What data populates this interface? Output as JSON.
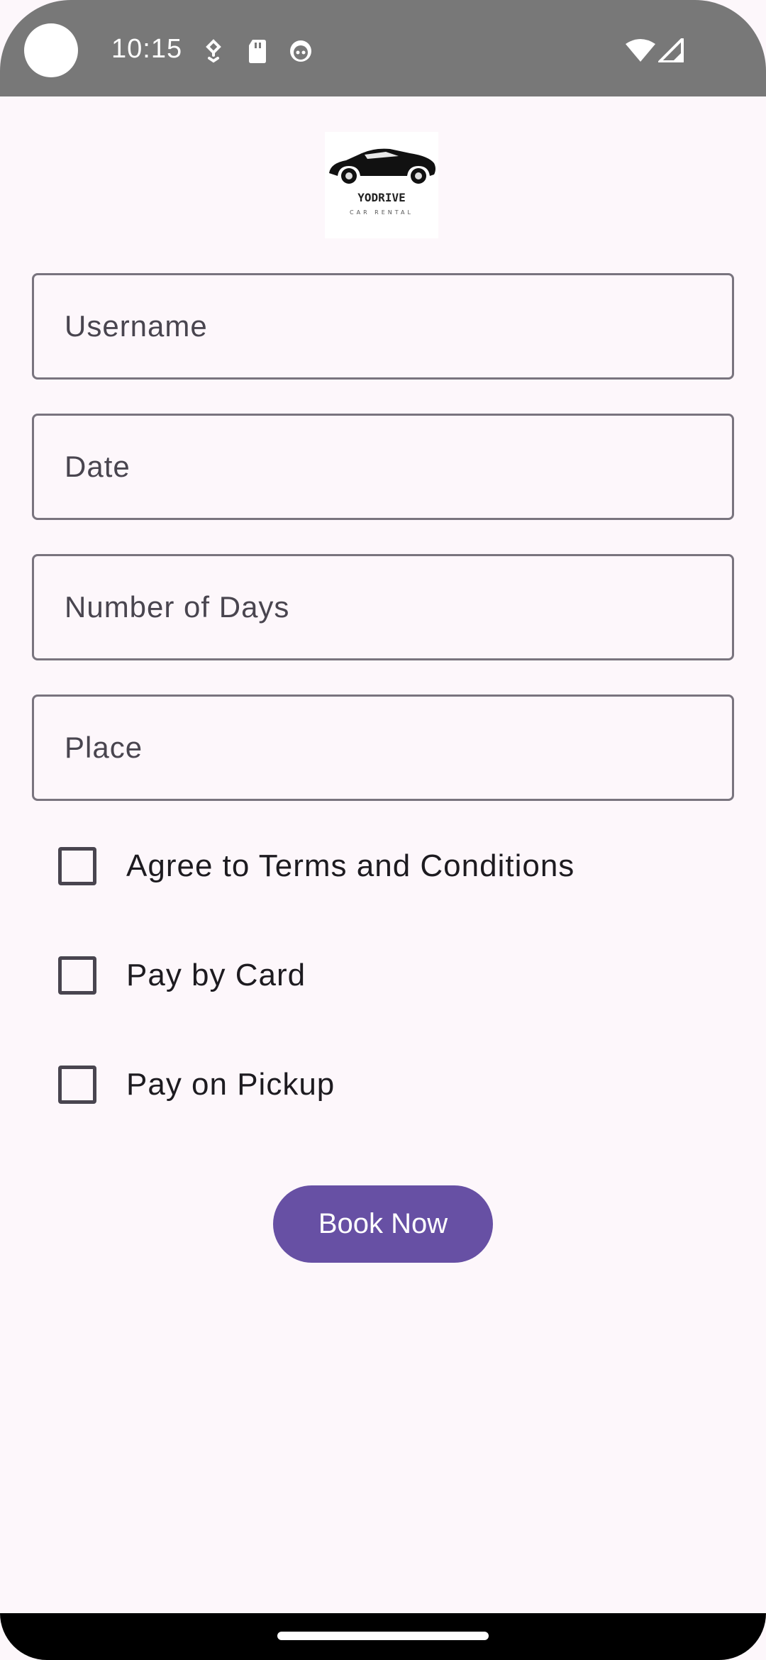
{
  "status_bar": {
    "time": "10:15",
    "icons": [
      "notification-icon",
      "sd-card-icon",
      "android-icon",
      "wifi-icon",
      "cell-signal-icon"
    ]
  },
  "logo": {
    "brand": "YODRIVE",
    "tagline": "CAR RENTAL"
  },
  "form": {
    "username_placeholder": "Username",
    "date_placeholder": "Date",
    "days_placeholder": "Number of Days",
    "place_placeholder": "Place"
  },
  "checkboxes": {
    "terms_label": "Agree to Terms and Conditions",
    "card_label": "Pay by Card",
    "pickup_label": "Pay on Pickup",
    "terms_checked": false,
    "card_checked": false,
    "pickup_checked": false
  },
  "actions": {
    "book_label": "Book Now"
  },
  "colors": {
    "background": "#fdf7fb",
    "status_bar": "#787878",
    "primary": "#6750a4",
    "outline": "#79747e"
  }
}
